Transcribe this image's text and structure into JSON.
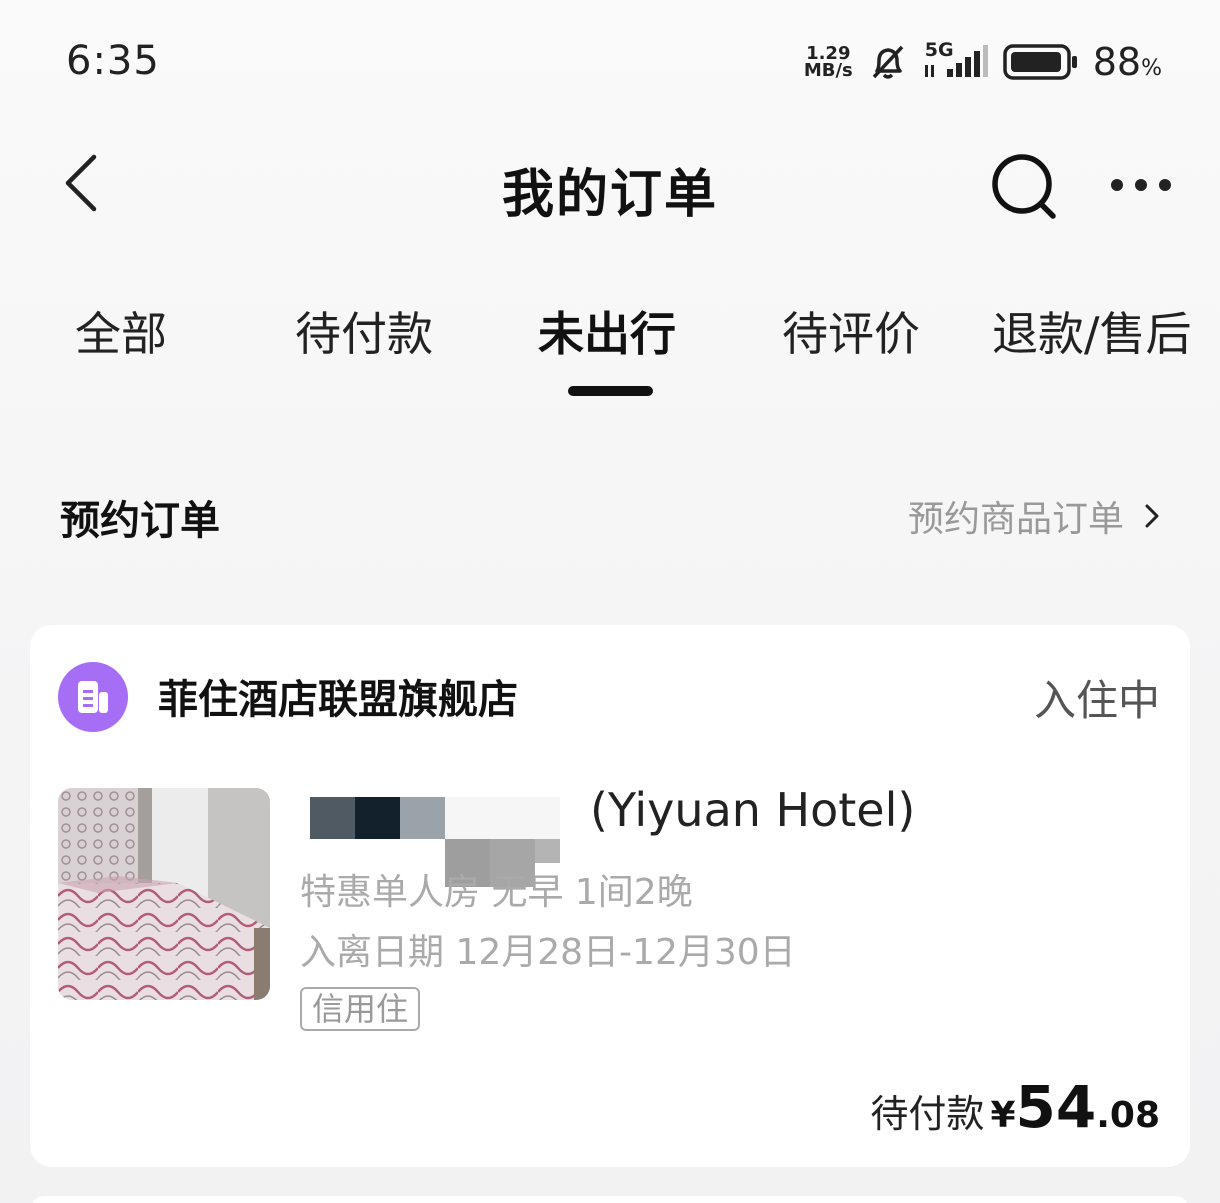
{
  "status_bar": {
    "time": "6:35",
    "net_speed_value": "1.29",
    "net_speed_unit": "MB/s",
    "network_type": "5G",
    "battery_level": "88",
    "battery_unit": "%",
    "icons": [
      "silent-bell-icon",
      "signal-icon",
      "battery-icon"
    ]
  },
  "nav": {
    "title": "我的订单",
    "icons": [
      "back-icon",
      "search-icon",
      "more-icon"
    ]
  },
  "tabs": [
    {
      "label": "全部",
      "active": false
    },
    {
      "label": "待付款",
      "active": false
    },
    {
      "label": "未出行",
      "active": true
    },
    {
      "label": "待评价",
      "active": false
    },
    {
      "label": "退款/售后",
      "active": false
    }
  ],
  "section": {
    "title": "预约订单",
    "link": "预约商品订单"
  },
  "order": {
    "shop_name": "菲住酒店联盟旗舰店",
    "status": "入住中",
    "hotel_name": "(Yiyuan Hotel)",
    "room_info": "特惠单人房 无早 1间2晚",
    "dates": "入离日期 12月28日-12月30日",
    "tag": "信用住",
    "price_label": "待付款",
    "price_symbol": "¥",
    "price_int": "54",
    "price_dec": ".08",
    "accent_color": "#a66ef5"
  }
}
